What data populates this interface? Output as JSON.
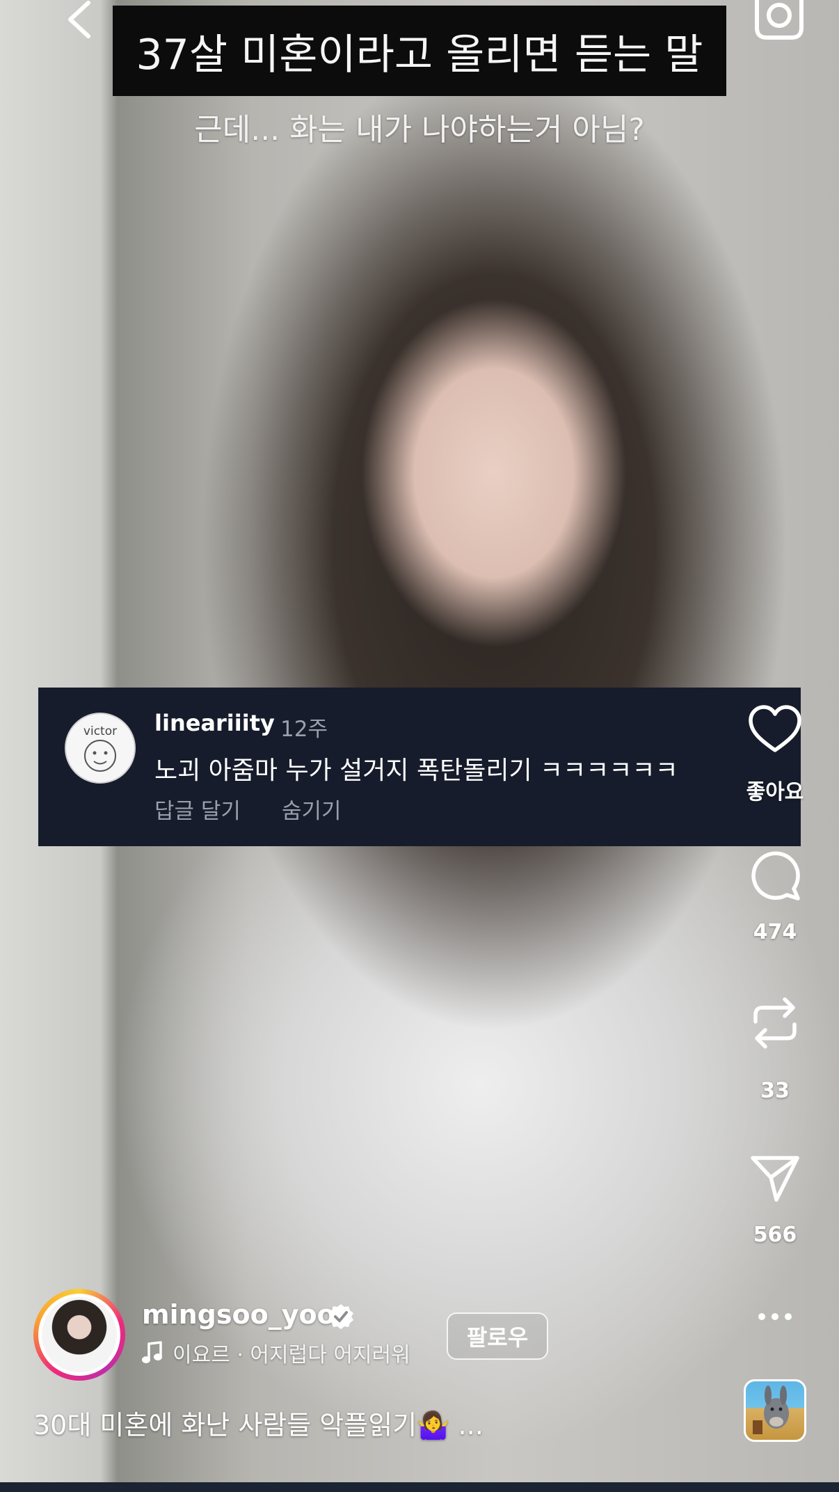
{
  "overlay": {
    "title": "37살 미혼이라고 올리면 듣는 말",
    "subtitle": "근데... 화는 내가 나야하는거 아님?"
  },
  "comment": {
    "username": "lineariiity",
    "time": "12주",
    "text": "노괴 아줌마 누가 설거지 폭탄돌리기 ㅋㅋㅋㅋㅋㅋ",
    "reply_label": "답글 달기",
    "hide_label": "숨기기",
    "avatar_text": "victor"
  },
  "rail": {
    "like_label": "좋아요",
    "comments_count": "474",
    "reposts_count": "33",
    "shares_count": "566"
  },
  "creator": {
    "username": "mingsoo_yoo",
    "music": "이요르 · 어지럽다 어지러워",
    "follow_label": "팔로우",
    "caption": "30대 미혼에 화난 사람들 악플읽기🤷‍♀️  ..."
  },
  "icons": [
    "back-chevron-icon",
    "camera-icon",
    "heart-icon",
    "comment-icon",
    "repost-icon",
    "send-icon",
    "more-icon",
    "verified-icon",
    "music-note-icon"
  ]
}
